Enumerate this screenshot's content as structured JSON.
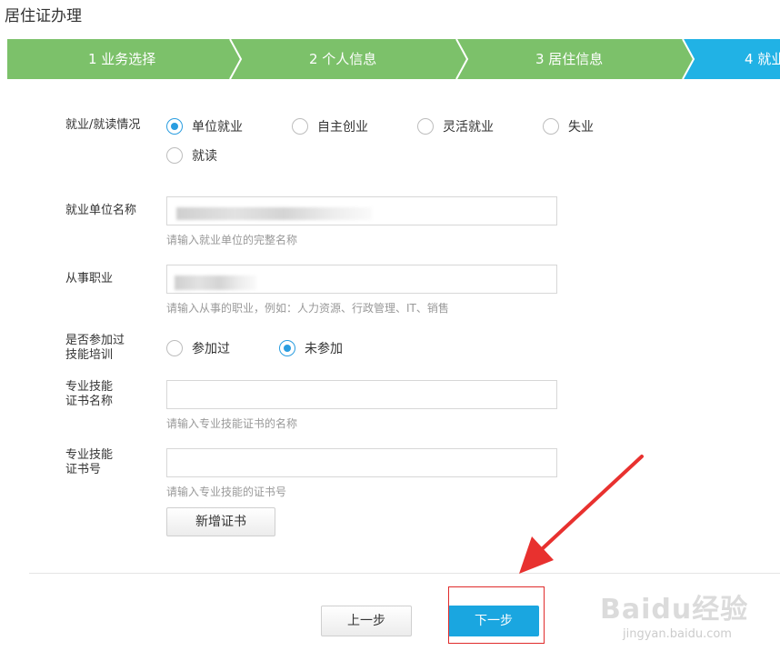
{
  "page": {
    "title": "居住证办理"
  },
  "steps": [
    {
      "label": "1  业务选择",
      "color": "#7cc16a"
    },
    {
      "label": "2  个人信息",
      "color": "#7cc16a"
    },
    {
      "label": "3  居住信息",
      "color": "#7cc16a"
    },
    {
      "label": "4  就业",
      "color": "#21b2e5"
    }
  ],
  "form": {
    "employment": {
      "label": "就业/就读情况",
      "options": [
        "单位就业",
        "自主创业",
        "灵活就业",
        "失业",
        "就读"
      ],
      "selected": "单位就业"
    },
    "employer": {
      "label": "就业单位名称",
      "value": "",
      "hint": "请输入就业单位的完整名称"
    },
    "occupation": {
      "label": "从事职业",
      "value": "",
      "hint": "请输入从事的职业，例如：人力资源、行政管理、IT、销售"
    },
    "training": {
      "label_line1": "是否参加过",
      "label_line2": "技能培训",
      "options": [
        "参加过",
        "未参加"
      ],
      "selected": "未参加"
    },
    "cert_name": {
      "label_line1": "专业技能",
      "label_line2": "证书名称",
      "value": "",
      "hint": "请输入专业技能证书的名称"
    },
    "cert_no": {
      "label_line1": "专业技能",
      "label_line2": "证书号",
      "value": "",
      "hint": "请输入专业技能的证书号"
    },
    "add_cert_label": "新增证书"
  },
  "footer": {
    "prev_label": "上一步",
    "next_label": "下一步"
  },
  "annotation": {
    "arrow_color": "#e8312f"
  },
  "watermark": {
    "logo": "Baidu经验",
    "url": "jingyan.baidu.com"
  }
}
